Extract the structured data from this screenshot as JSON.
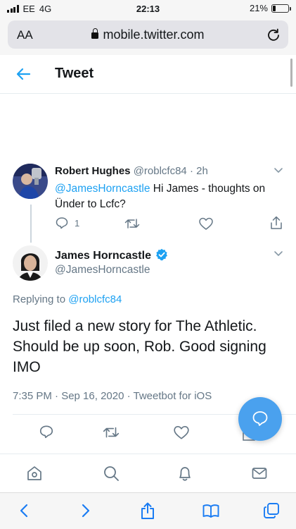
{
  "status_bar": {
    "carrier": "EE",
    "network": "4G",
    "time": "22:13",
    "battery": "21%",
    "battery_level": 0.21
  },
  "browser": {
    "text_size_label": "AA",
    "url": "mobile.twitter.com"
  },
  "header": {
    "title": "Tweet"
  },
  "parent_tweet": {
    "author_name": "Robert Hughes",
    "handle": "@roblcfc84",
    "separator": "·",
    "time_ago": "2h",
    "mention": "@JamesHorncastle",
    "text": " Hi James - thoughts on Ünder to Lcfc?",
    "reply_count": "1"
  },
  "main_tweet": {
    "author_name": "James Horncastle",
    "handle": "@JamesHorncastle",
    "replying_prefix": "Replying to ",
    "replying_to": "@roblcfc84",
    "text": "Just filed a new story for The Athletic. Should be up soon, Rob. Good signing IMO",
    "timestamp": "7:35 PM · Sep 16, 2020 · Tweetbot for iOS"
  },
  "colors": {
    "accent": "#1da1f2",
    "muted": "#657786",
    "fab": "#4aa1ee",
    "verified": "#1da1f2"
  },
  "icons": {
    "nav": [
      "home-icon",
      "search-icon",
      "notifications-icon",
      "messages-icon"
    ],
    "safari": [
      "back-icon",
      "forward-icon",
      "share-icon",
      "bookmarks-icon",
      "tabs-icon"
    ]
  }
}
